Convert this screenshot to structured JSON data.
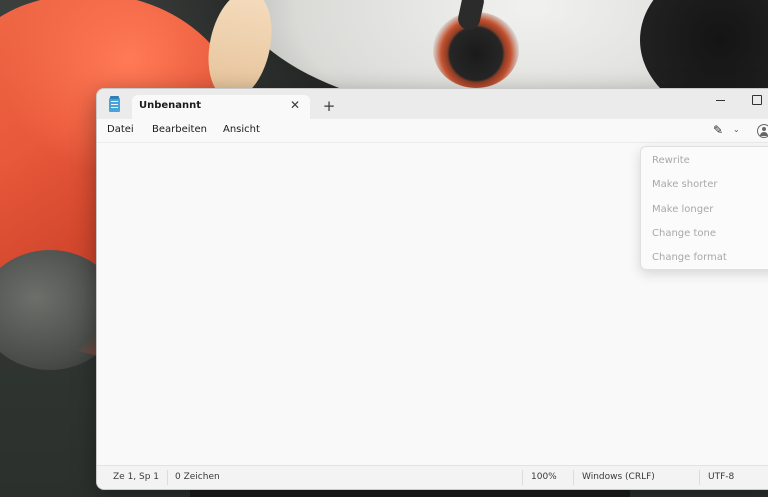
{
  "window": {
    "tab_title": "Unbenannt",
    "tab_close_glyph": "✕",
    "new_tab_glyph": "+"
  },
  "menu": {
    "items": [
      "Datei",
      "Bearbeiten",
      "Ansicht"
    ]
  },
  "toolbar": {
    "ai_icon": "pen-sparkle-icon",
    "ai_glyph": "✎",
    "chevron_glyph": "⌄",
    "account_icon": "account-icon"
  },
  "rewrite_menu": {
    "items": [
      "Rewrite",
      "Make shorter",
      "Make longer",
      "Change tone",
      "Change format"
    ],
    "disabled_color": "#a8a8a8"
  },
  "editor": {
    "content": ""
  },
  "status": {
    "position": "Ze 1, Sp 1",
    "characters": "0 Zeichen",
    "zoom": "100%",
    "line_ending": "Windows (CRLF)",
    "encoding": "UTF-8"
  },
  "colors": {
    "app_icon": "#4aa3d8",
    "window_bg": "#f9f9f9",
    "titlebar_bg": "#ebebeb"
  }
}
